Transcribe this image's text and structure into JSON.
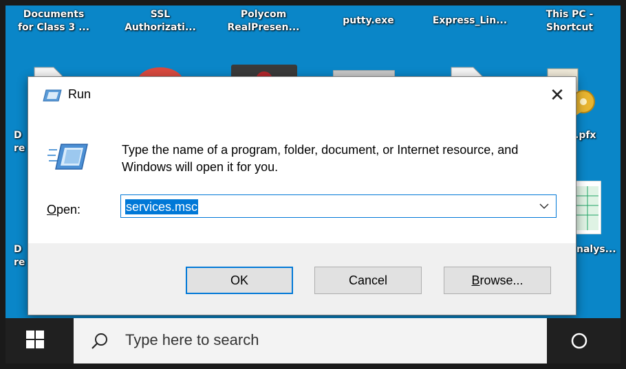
{
  "desktop": {
    "icons_top": [
      {
        "label": "Documents\nfor Class 3 ..."
      },
      {
        "label": "SSL\nAuthorizati..."
      },
      {
        "label": "Polycom\nRealPresen..."
      },
      {
        "label": "putty.exe"
      },
      {
        "label": "Express_Lin..."
      },
      {
        "label": "This PC -\nShortcut"
      }
    ],
    "left_fragments": [
      "D\nre",
      "D\nre"
    ],
    "right_fragments": [
      ".pfx",
      "nalys..."
    ]
  },
  "run_dialog": {
    "title": "Run",
    "message": "Type the name of a program, folder, document, or Internet resource, and Windows will open it for you.",
    "open_label_underlined": "O",
    "open_label_rest": "pen:",
    "input_value": "services.msc",
    "ok_label": "OK",
    "cancel_label": "Cancel",
    "browse_label_underlined": "B",
    "browse_label_rest": "rowse...",
    "close_glyph": "✕"
  },
  "taskbar": {
    "search_placeholder": "Type here to search"
  },
  "colors": {
    "desktop": "#0a86c8",
    "accent": "#0078d7",
    "taskbar": "#202020"
  }
}
